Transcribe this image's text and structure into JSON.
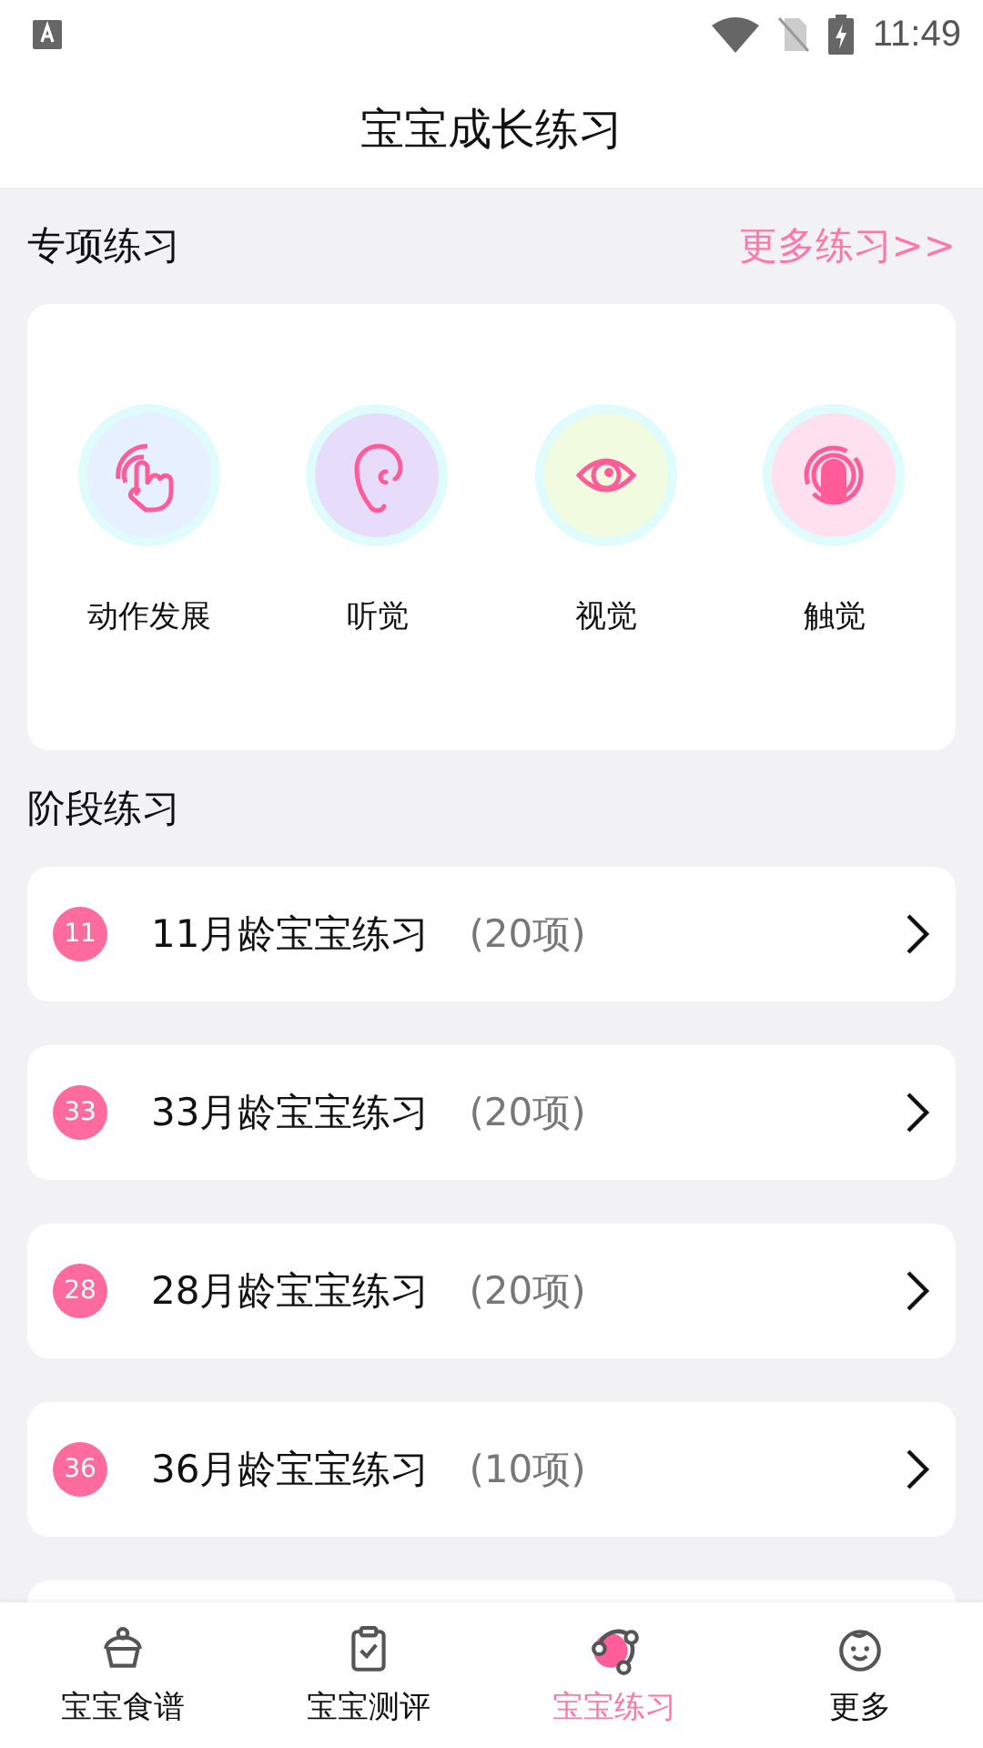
{
  "status_bar": {
    "time": "11:49"
  },
  "header": {
    "title": "宝宝成长练习"
  },
  "special": {
    "title": "专项练习",
    "more_link": "更多练习>>",
    "items": [
      {
        "label": "动作发展",
        "color": "#e6f0ff"
      },
      {
        "label": "听觉",
        "color": "#e8dcfb"
      },
      {
        "label": "视觉",
        "color": "#f1fbdf"
      },
      {
        "label": "触觉",
        "color": "#ffe0ee"
      }
    ]
  },
  "stages": {
    "title": "阶段练习",
    "rows": [
      {
        "badge": "11",
        "name": "11月龄宝宝练习",
        "count": "(20项)"
      },
      {
        "badge": "33",
        "name": "33月龄宝宝练习",
        "count": "(20项)"
      },
      {
        "badge": "28",
        "name": "28月龄宝宝练习",
        "count": "(20项)"
      },
      {
        "badge": "36",
        "name": "36月龄宝宝练习",
        "count": "(10项)"
      }
    ]
  },
  "tabs": [
    {
      "label": "宝宝食谱",
      "selected": false
    },
    {
      "label": "宝宝测评",
      "selected": false
    },
    {
      "label": "宝宝练习",
      "selected": true
    },
    {
      "label": "更多",
      "selected": false
    }
  ]
}
